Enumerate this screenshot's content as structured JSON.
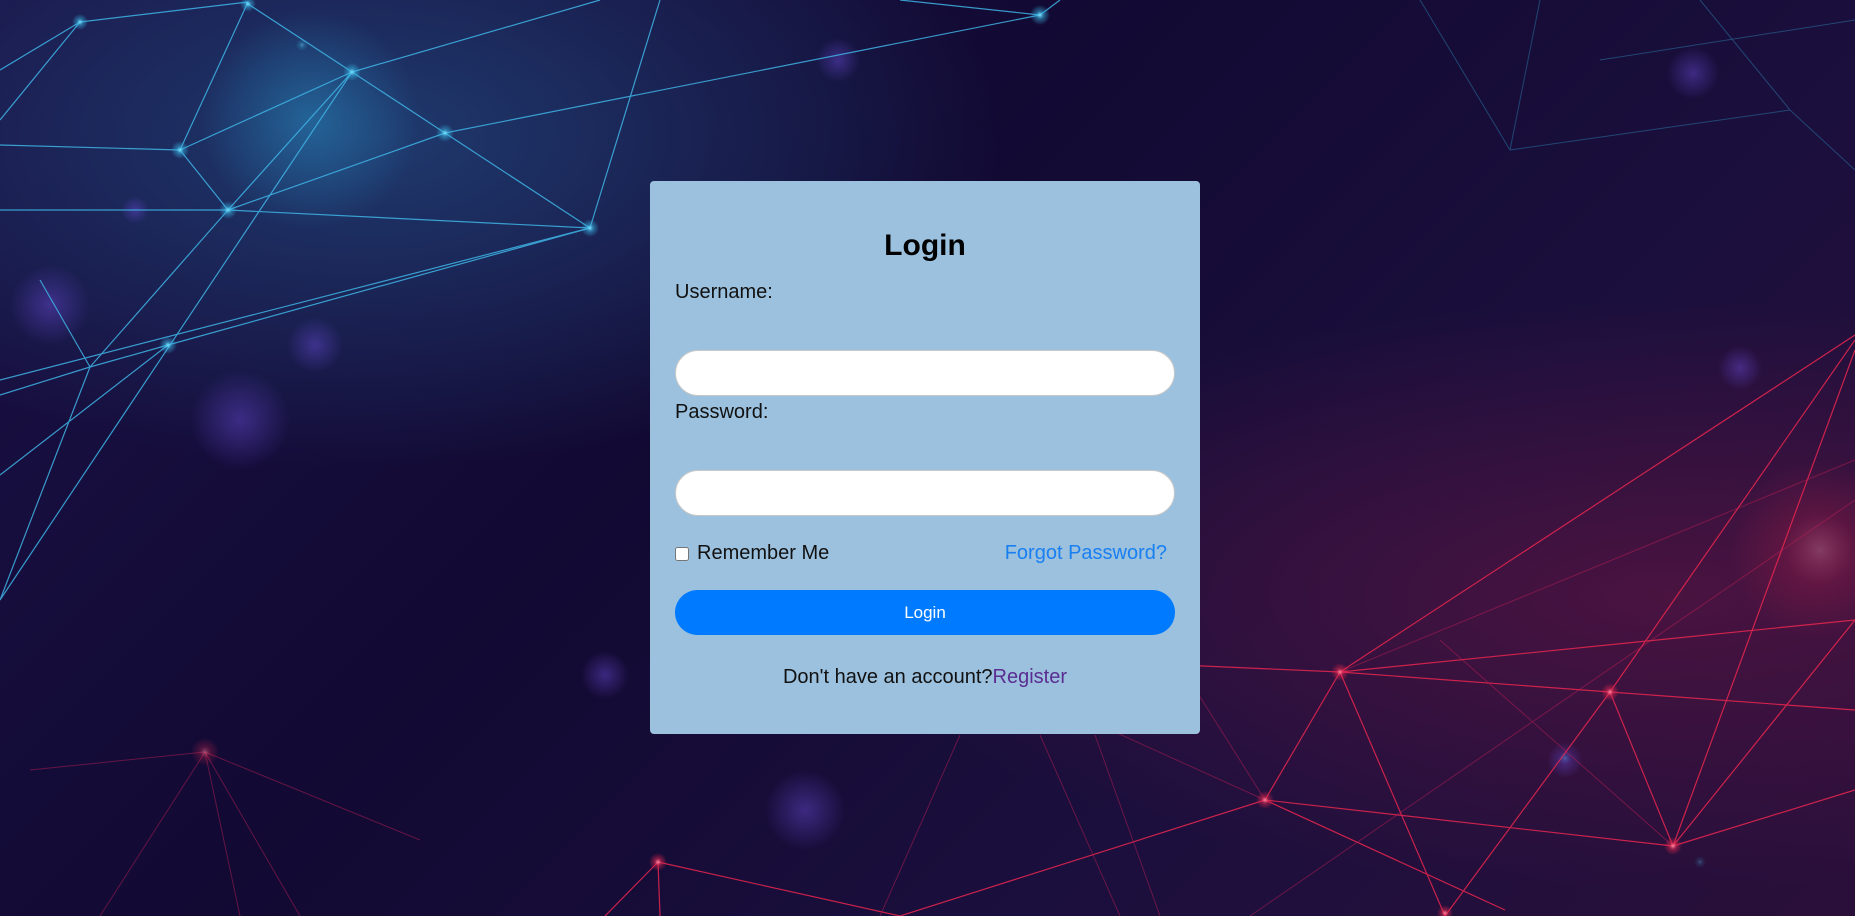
{
  "page": {
    "background_accent_blue": "#39b6e6",
    "background_accent_red": "#e8264f",
    "card_color": "#9bc1de"
  },
  "login_form": {
    "title": "Login",
    "username_label": "Username:",
    "username_value": "",
    "password_label": "Password:",
    "password_value": "",
    "remember_label": "Remember Me",
    "remember_checked": false,
    "forgot_link": "Forgot Password?",
    "submit_label": "Login",
    "register_prompt": "Don't have an account?",
    "register_link": "Register",
    "accent_color": "#007bff"
  }
}
